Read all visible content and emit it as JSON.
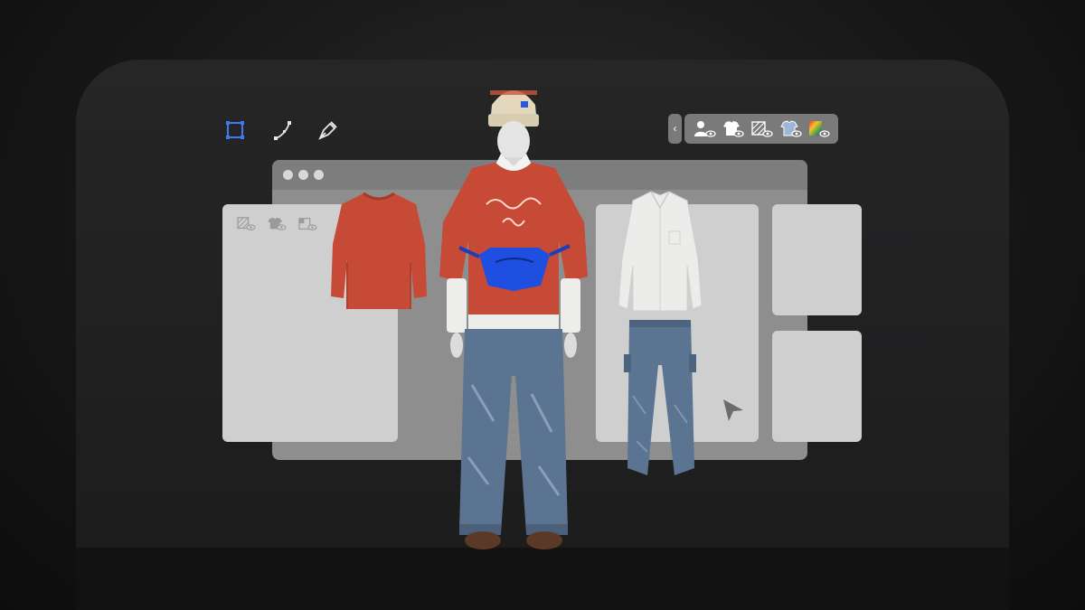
{
  "toolbar_left": {
    "tools": [
      {
        "name": "rectangle-select-icon",
        "active": true
      },
      {
        "name": "curve-tool-icon",
        "active": false
      },
      {
        "name": "pen-tool-icon",
        "active": false
      }
    ],
    "active_color": "#3d7bf5"
  },
  "visibility_panel": {
    "collapse_glyph": "‹",
    "toggles": [
      {
        "name": "avatar-visibility-icon"
      },
      {
        "name": "garment-visibility-icon"
      },
      {
        "name": "pattern-visibility-icon"
      },
      {
        "name": "garment-texture-visibility-icon"
      },
      {
        "name": "color-visibility-icon"
      }
    ]
  },
  "window": {
    "traffic_lights": 3
  },
  "scene": {
    "items": [
      "sweater",
      "avatar-outfit",
      "shirt",
      "jeans"
    ],
    "colors": {
      "sweater": "#c64a35",
      "bag": "#1f4fe0",
      "denim": "#5b7491",
      "shirt": "#ececea",
      "beanie": "#e3d7bd"
    }
  }
}
